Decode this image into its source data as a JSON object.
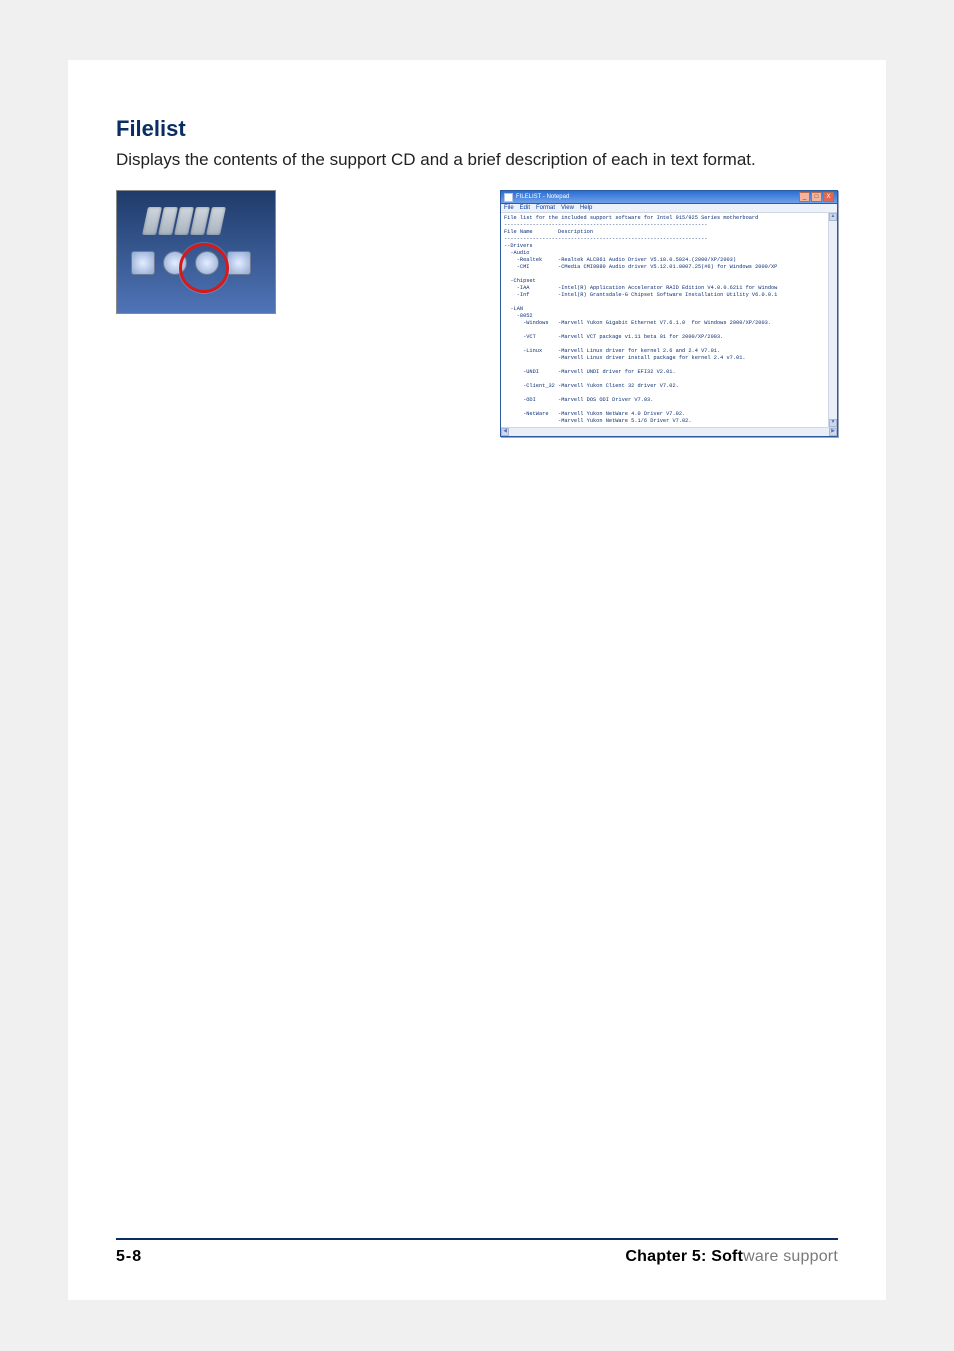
{
  "section": {
    "title": "Filelist",
    "body": "Displays the contents of the support CD and a brief description of each in text format."
  },
  "thumb": {
    "icon_names": [
      "grid-icon",
      "disc-icon",
      "tools-icon",
      "doc-icon"
    ]
  },
  "notepad": {
    "title": "FILELIST - Notepad",
    "menu": [
      "File",
      "Edit",
      "Format",
      "View",
      "Help"
    ],
    "close_label": "X",
    "min_label": "_",
    "max_label": "□",
    "text": "File list for the included support software for Intel 915/925 Series motherboard\n----------------------------------------------------------------\nFile Name        Description\n----------------------------------------------------------------\n--Drivers\n  -Audio\n    -Realtek     -Realtek ALC861 Audio Driver V5.10.0.5024.(2000/XP/2003)\n    -CMI         -CMedia CMI9880 Audio driver V5.12.01.0007.25(#6) for Windows 2000/XP\n\n  -Chipset\n    -IAA         -Intel(R) Application Accelerator RAID Edition V4.0.0.6211 for Window\n    -Inf         -Intel(R) Grantsdale-G Chipset Software Installation Utility V6.0.0.1\n\n  -LAN\n    -8052\n      -Windows   -Marvell Yukon Gigabit Ethernet V7.6.1.0  for Windows 2000/XP/2003.\n\n      -VCT       -Marvell VCT package v1.11 beta 01 for 2000/XP/2003.\n\n      -Linux     -Marvell Linux driver for kernel 2.6 and 2.4 V7.01.\n                 -Marvell Linux driver install package for kernel 2.4 v7.01.\n\n      -UNDI      -Marvell UNDI driver for EFI32 V2.01.\n\n      -Client_32 -Marvell Yukon Client 32 driver V7.02.\n\n      -ODI       -Marvell DOS ODI Driver V7.03.\n\n      -NetWare   -Marvell Yukon NetWare 4.0 Driver V7.02.\n                 -Marvell Yukon NetWare 5.1/6 Driver V7.02."
  },
  "footer": {
    "left": "5-8",
    "right_prefix": "Chapter 5: Soft",
    "right_suffix": "ware support"
  }
}
